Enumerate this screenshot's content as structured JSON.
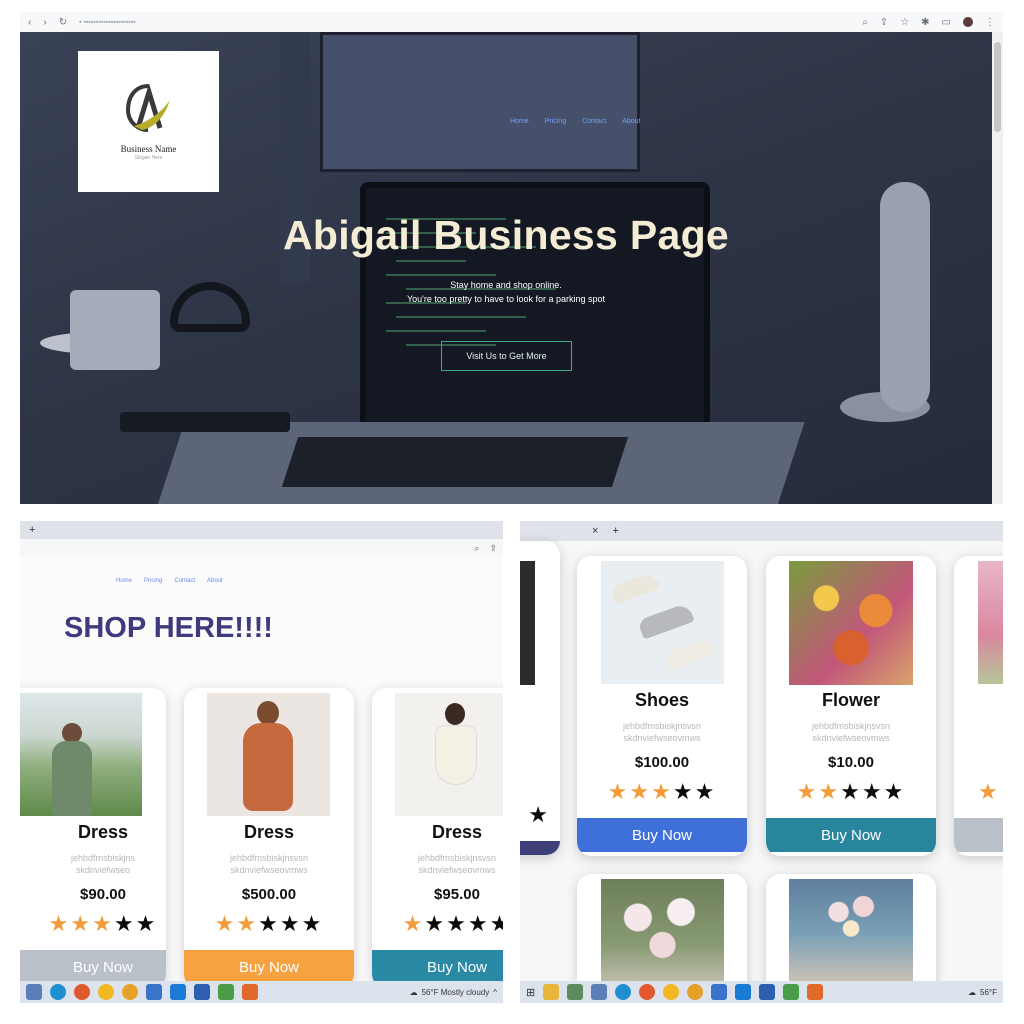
{
  "colors": {
    "nav_link": "#6ea2ff",
    "hero_title": "#f4ecd4",
    "hero_button_border": "#3fae86",
    "shop_title": "#3d3b7c",
    "star_on": "#f49c3c",
    "star_off": "#0b0b0b"
  },
  "hero": {
    "logo": {
      "name": "Business Name",
      "tagline": "Slogan Here"
    },
    "nav": [
      "Home",
      "Pricing",
      "Contact",
      "About"
    ],
    "title": "Abigail Business Page",
    "subtitle_line1": "Stay home and shop online.",
    "subtitle_line2": "You're too pretty to have to look for a parking spot",
    "cta": "Visit Us to Get More"
  },
  "shop": {
    "tab_plus": "+",
    "nav": [
      "Home",
      "Pricing",
      "Contact",
      "About"
    ],
    "title": "SHOP HERE!!!!",
    "products": [
      {
        "name": "Dress",
        "desc1": "jehbdfmsbiskjns",
        "desc2": "skdnviefwseo",
        "price": "$90.00",
        "rating": 3,
        "button": "Buy Now",
        "button_color": "#b9c0c8"
      },
      {
        "name": "Dress",
        "desc1": "jehbdfmsbiskjnsvsn",
        "desc2": "skdnviefwseovmws",
        "price": "$500.00",
        "rating": 2,
        "button": "Buy Now",
        "button_color": "#f6a241"
      },
      {
        "name": "Dress",
        "desc1": "jehbdfmsbiskjnsvsn",
        "desc2": "skdnviefwseovmws",
        "price": "$95.00",
        "rating": 1,
        "button": "Buy Now",
        "button_color": "#2a89a4"
      }
    ],
    "weather": "56°F  Mostly cloudy"
  },
  "shop2": {
    "tab_close": "×",
    "tab_plus": "+",
    "products": [
      {
        "name": "Shoes",
        "desc1": "jehbdfmsbiskjnsvsn",
        "desc2": "skdnviefwseovmws",
        "price": "$100.00",
        "rating": 3,
        "button": "Buy Now",
        "button_color": "#3f6fd8"
      },
      {
        "name": "Flower",
        "desc1": "jehbdfmsbiskjnsvsn",
        "desc2": "skdnviefwseovmws",
        "price": "$10.00",
        "rating": 2,
        "button": "Buy Now",
        "button_color": "#27859e"
      }
    ],
    "weather": "56°F"
  }
}
